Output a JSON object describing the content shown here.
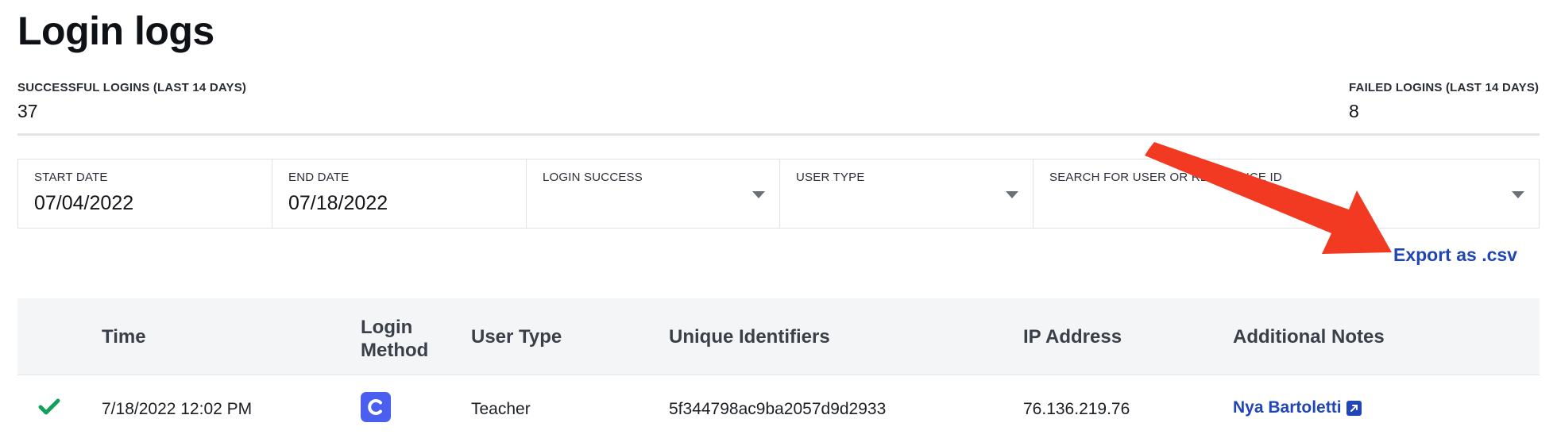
{
  "page": {
    "title": "Login logs"
  },
  "stats": {
    "successful": {
      "label": "SUCCESSFUL LOGINS (LAST 14 DAYS)",
      "value": "37"
    },
    "failed": {
      "label": "FAILED LOGINS (LAST 14 DAYS)",
      "value": "8"
    }
  },
  "filters": {
    "start_date": {
      "label": "START DATE",
      "value": "07/04/2022"
    },
    "end_date": {
      "label": "END DATE",
      "value": "07/18/2022"
    },
    "login_success": {
      "label": "LOGIN SUCCESS",
      "value": ""
    },
    "user_type": {
      "label": "USER TYPE",
      "value": ""
    },
    "search": {
      "label": "SEARCH FOR USER OR REFERENCE ID",
      "value": ""
    }
  },
  "export": {
    "label": "Export as .csv"
  },
  "table": {
    "headers": {
      "time": "Time",
      "login_method_1": "Login",
      "login_method_2": "Method",
      "user_type": "User Type",
      "unique_identifiers": "Unique Identifiers",
      "ip_address": "IP Address",
      "additional_notes": "Additional Notes"
    },
    "rows": [
      {
        "status_icon": "check-icon",
        "time": "7/18/2022 12:02 PM",
        "login_method_icon": "clever-icon",
        "user_type": "Teacher",
        "unique_identifier": "5f344798ac9ba2057d9d2933",
        "ip_address": "76.136.219.76",
        "note": "Nya Bartoletti"
      }
    ]
  },
  "colors": {
    "link": "#1f45b8",
    "success": "#14a05c",
    "annotation_arrow": "#f23a22",
    "method_icon_bg": "#4a5ef0",
    "header_bg": "#f4f5f7"
  }
}
